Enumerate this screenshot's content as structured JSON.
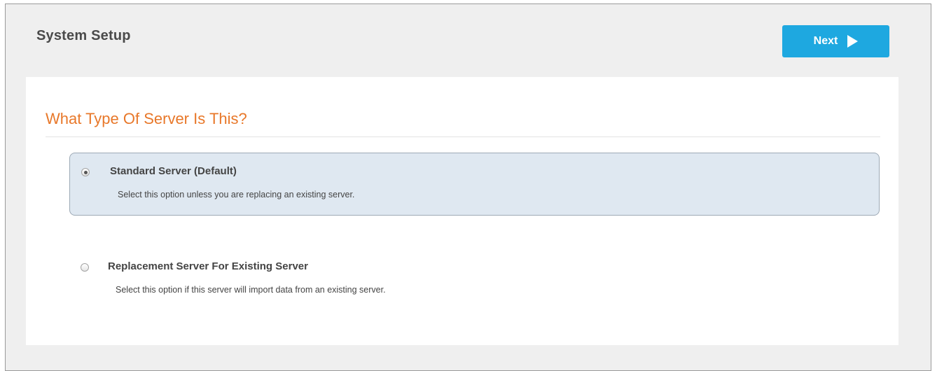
{
  "header": {
    "title": "System Setup",
    "next_label": "Next",
    "next_icon": "play-triangle-icon"
  },
  "question": {
    "title": "What Type Of Server Is This?"
  },
  "options": [
    {
      "label": "Standard Server (Default)",
      "description": "Select this option unless you are replacing an existing server.",
      "selected": true
    },
    {
      "label": "Replacement Server For Existing Server",
      "description": "Select this option if this server will import data from an existing server.",
      "selected": false
    }
  ],
  "colors": {
    "accent": "#1ea8e0",
    "section_title": "#e8782a",
    "selected_option_bg": "#dfe8f1"
  }
}
